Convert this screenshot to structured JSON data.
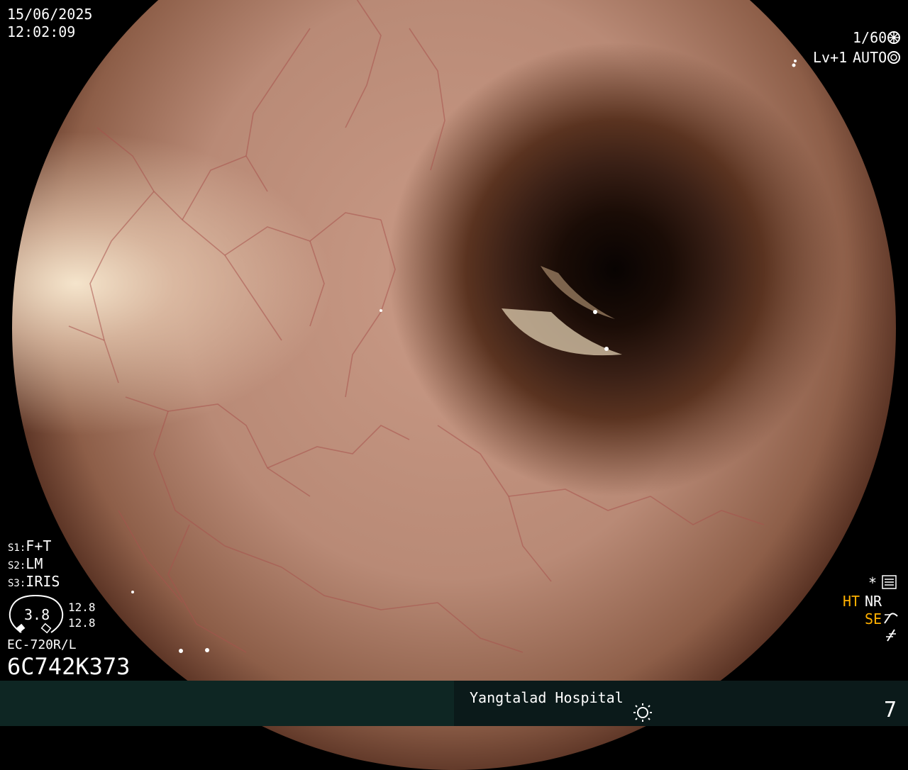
{
  "top_left": {
    "date": "15/06/2025",
    "time": "12:02:09"
  },
  "top_right": {
    "shutter": "1/60",
    "level": "Lv+1",
    "iris_mode": "AUTO"
  },
  "settings": {
    "s1_key": "S1:",
    "s1_val": "F+T",
    "s2_key": "S2:",
    "s2_val": "LM",
    "s3_key": "S3:",
    "s3_val": "IRIS"
  },
  "gauge": {
    "center_value": "3.8",
    "value_a": "12.8",
    "value_b": "12.8"
  },
  "scope": {
    "model": "EC-720R/L",
    "serial": "6C742K373"
  },
  "right_panel": {
    "star": "*",
    "ht": "HT",
    "nr": "NR",
    "se": "SE"
  },
  "footer": {
    "hospital": "Yangtalad Hospital",
    "image_number": "7"
  },
  "colors": {
    "amber": "#ffb000",
    "footer_left": "#0e2623",
    "footer_right": "#0b1a1a"
  },
  "icons": [
    "aperture-icon",
    "iris-icon",
    "settings-menu-icon",
    "curve-icon",
    "freeze-icon",
    "light-icon"
  ]
}
